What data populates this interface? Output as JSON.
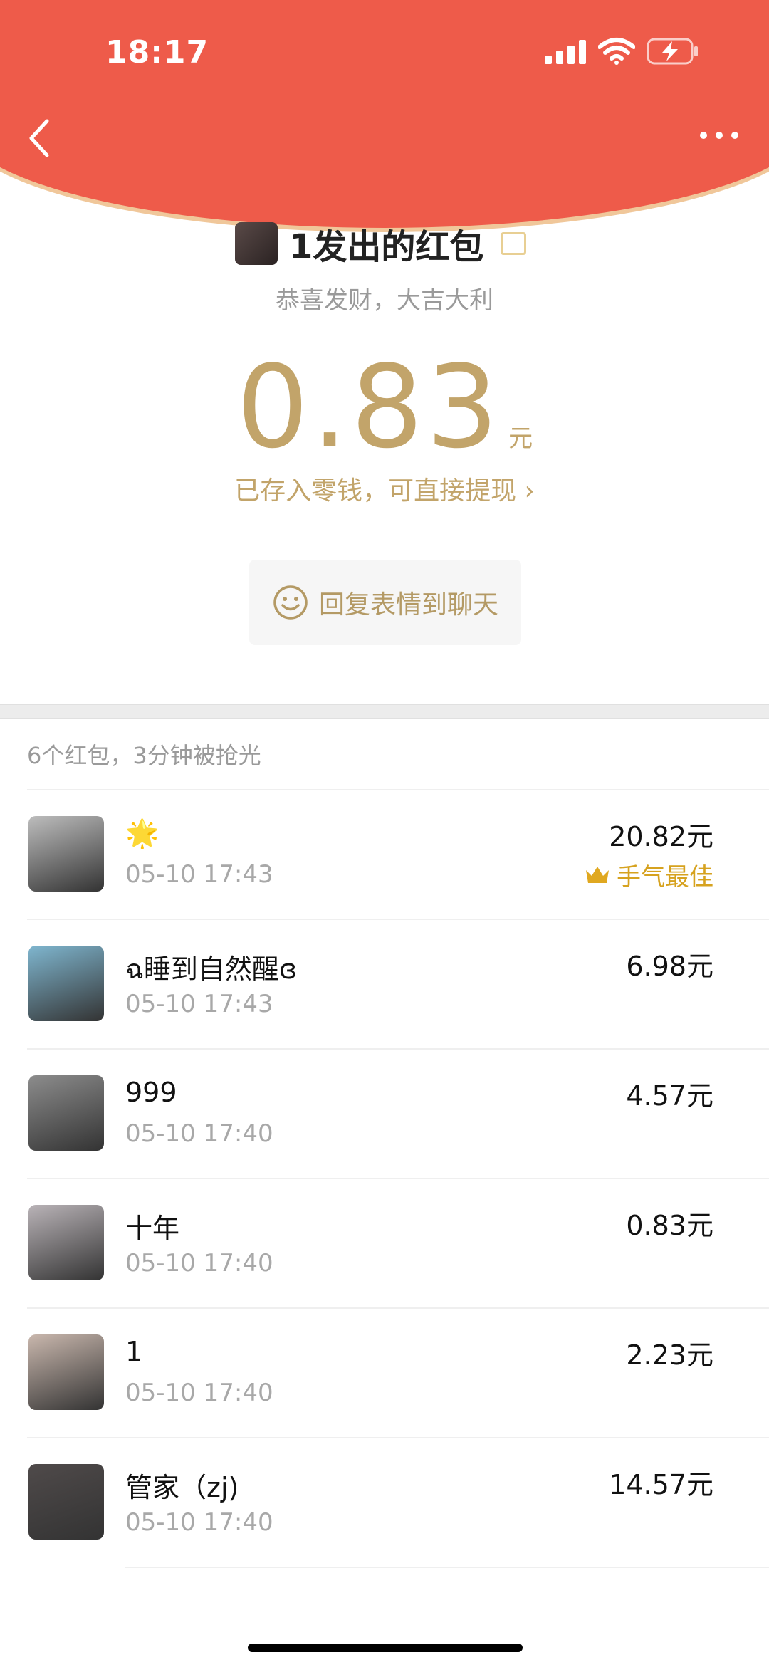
{
  "status_bar": {
    "time": "18:17"
  },
  "sender": {
    "title": "1发出的红包"
  },
  "greeting": "恭喜发财，大吉大利",
  "amount": {
    "value": "0.83",
    "unit": "元"
  },
  "wallet_link": "已存入零钱，可直接提现 ›",
  "reply_button": {
    "label": "回复表情到聊天"
  },
  "summary": "6个红包，3分钟被抢光",
  "best_luck_label": "手气最佳",
  "records": [
    {
      "name": "🌟",
      "time": "05-10 17:43",
      "amount": "20.82元",
      "best": true,
      "avatar_color": "#bdbdbd"
    },
    {
      "name": "ฉ睡到自然醒ɞ",
      "time": "05-10 17:43",
      "amount": "6.98元",
      "best": false,
      "avatar_color": "#7fb6cf"
    },
    {
      "name": "999",
      "time": "05-10 17:40",
      "amount": "4.57元",
      "best": false,
      "avatar_color": "#8c8c8c"
    },
    {
      "name": "十年",
      "time": "05-10 17:40",
      "amount": "0.83元",
      "best": false,
      "avatar_color": "#b9b3b7"
    },
    {
      "name": "1",
      "time": "05-10 17:40",
      "amount": "2.23元",
      "best": false,
      "avatar_color": "#c9b7ad"
    },
    {
      "name": "管家（zj)",
      "time": "05-10 17:40",
      "amount": "14.57元",
      "best": false,
      "avatar_color": "#4f4a4a"
    }
  ],
  "colors": {
    "header": "#ee5b4a",
    "gold": "#c2a46a",
    "best": "#d6a21f"
  }
}
